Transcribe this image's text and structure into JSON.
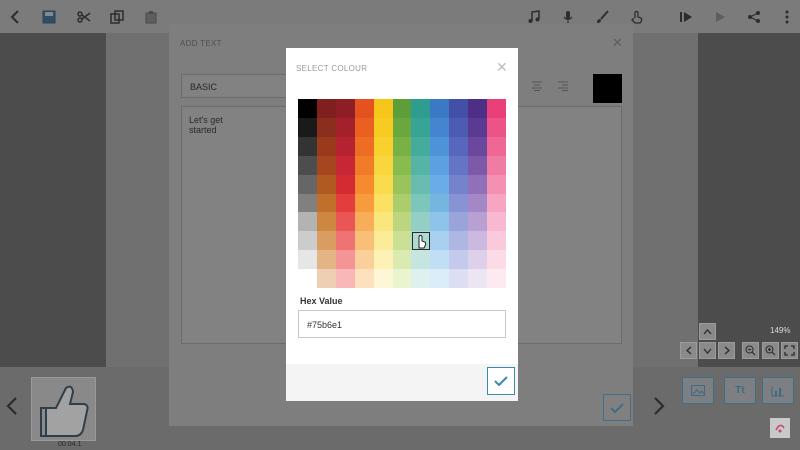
{
  "toolbar": {
    "left_icons": [
      "back-icon",
      "save-icon",
      "cut-icon",
      "copy-icon",
      "paste-icon"
    ],
    "right_icons": [
      "music-icon",
      "mic-icon",
      "brush-icon",
      "touch-icon",
      "play-from-icon",
      "play-icon",
      "share-icon",
      "more-icon"
    ]
  },
  "stage": {
    "zoom_label": "149%"
  },
  "add_text_dialog": {
    "title": "ADD TEXT",
    "style_value": "BASIC",
    "text_value": "Let's get started",
    "colour_swatch": "#000000"
  },
  "colour_dialog": {
    "title": "SELECT COLOUR",
    "hex_label": "Hex Value",
    "hex_value": "#75b6e1",
    "palette_columns": [
      [
        "#000000",
        "#1a1a1a",
        "#333333",
        "#4d4d4d",
        "#666666",
        "#808080",
        "#b3b3b3",
        "#cccccc",
        "#e6e6e6",
        "#ffffff"
      ],
      [
        "#7f1f1f",
        "#8b2e1d",
        "#9a3a1c",
        "#a5461f",
        "#b05a22",
        "#c0702a",
        "#cd8741",
        "#d99d62",
        "#e4b487",
        "#efcfb3"
      ],
      [
        "#8e1d25",
        "#a4202a",
        "#b52230",
        "#c72734",
        "#d42a32",
        "#e43d3d",
        "#ea5656",
        "#f07373",
        "#f59494",
        "#f9b7b7"
      ],
      [
        "#e3521f",
        "#ea6021",
        "#ee6d24",
        "#f27b28",
        "#f58b2e",
        "#f69c3e",
        "#f8ad58",
        "#f9be77",
        "#fbcf99",
        "#fde0bd"
      ],
      [
        "#f7c61a",
        "#f8cb22",
        "#f9d12f",
        "#f9d63d",
        "#fadb4d",
        "#fbe064",
        "#fbe67d",
        "#fcec99",
        "#fdf1b6",
        "#fef7d5"
      ],
      [
        "#5d9e3a",
        "#6aa83f",
        "#78b246",
        "#89bc4e",
        "#9ac45b",
        "#abcd6b",
        "#bbd67e",
        "#cbe095",
        "#dbeab0",
        "#eaf4cf"
      ],
      [
        "#2e9c8e",
        "#38a496",
        "#45ac9d",
        "#55b4a6",
        "#68bdb0",
        "#7dc6bb",
        "#94cfc6",
        "#addad3",
        "#c6e5e0",
        "#dff1ee"
      ],
      [
        "#3a79c4",
        "#4386cf",
        "#4d93d8",
        "#5ba0e0",
        "#6aade6",
        "#75b6e1",
        "#8ec3ea",
        "#a7d1ef",
        "#c1dff4",
        "#dbedf9"
      ],
      [
        "#4350a8",
        "#4d5bb3",
        "#5867bd",
        "#6574c5",
        "#7582cc",
        "#8793d4",
        "#9aa4db",
        "#aeb6e3",
        "#c4caeb",
        "#dcdff4"
      ],
      [
        "#4d2f86",
        "#5b3a92",
        "#6b489d",
        "#7d59aa",
        "#9070b8",
        "#a488c6",
        "#b8a0d3",
        "#cbb9df",
        "#dcd0ea",
        "#ece6f4"
      ],
      [
        "#e9407b",
        "#ec5487",
        "#ef6895",
        "#f17ca3",
        "#f491b3",
        "#f6a5c2",
        "#f8b8cf",
        "#fac9db",
        "#fcdae6",
        "#fdeaf1"
      ]
    ],
    "selected_hex": "#75b6e1"
  },
  "bottom": {
    "thumb_time": "00:04.1",
    "media_buttons": [
      "image-icon",
      "text-icon",
      "chart-icon"
    ]
  }
}
